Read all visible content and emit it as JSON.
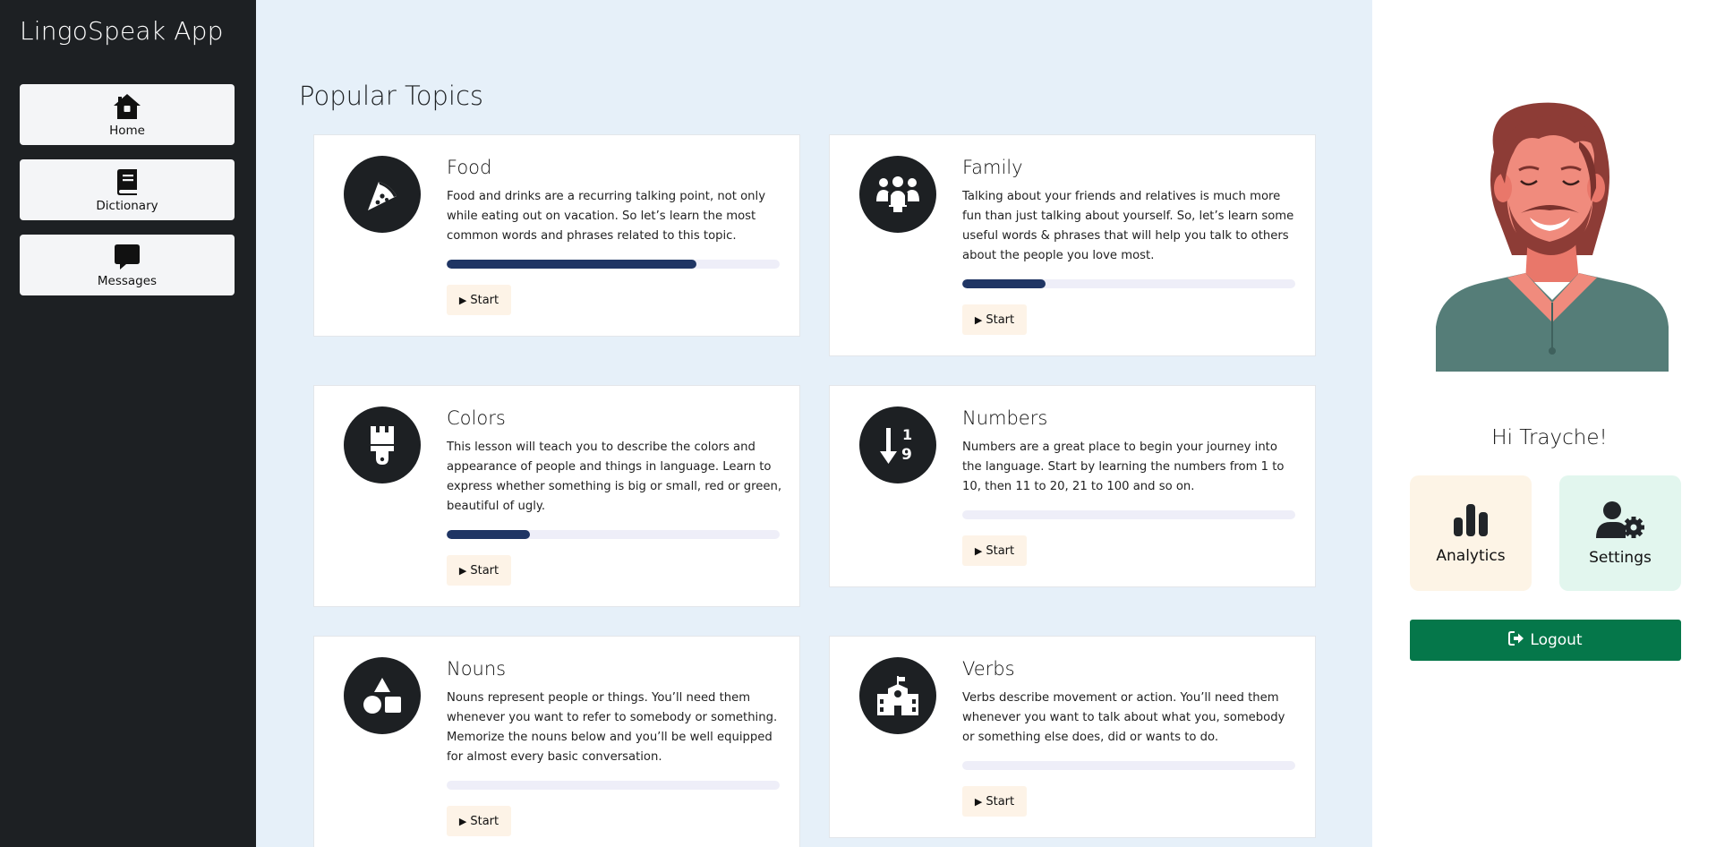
{
  "app": {
    "title": "LingoSpeak App"
  },
  "sidebar": {
    "items": [
      {
        "label": "Home",
        "icon": "home-icon"
      },
      {
        "label": "Dictionary",
        "icon": "book-icon"
      },
      {
        "label": "Messages",
        "icon": "message-icon"
      }
    ]
  },
  "main": {
    "title": "Popular Topics",
    "topics": [
      {
        "title": "Food",
        "icon": "pizza-icon",
        "description": "Food and drinks are a recurring talking point, not only while eating out on vacation. So let’s learn the most common words and phrases related to this topic.",
        "progress": 0.75,
        "start_label": "Start"
      },
      {
        "title": "Family",
        "icon": "people-group-icon",
        "description": "Talking about your friends and relatives is much more fun than just talking about yourself. So, let’s learn some useful words & phrases that will help you talk to others about the people you love most.",
        "progress": 0.25,
        "start_label": "Start"
      },
      {
        "title": "Colors",
        "icon": "paintbrush-icon",
        "description": "This lesson will teach you to describe the colors and appearance of people and things in language. Learn to express whether something is big or small, red or green, beautiful of ugly.",
        "progress": 0.25,
        "start_label": "Start"
      },
      {
        "title": "Numbers",
        "icon": "sort-numeric-down-icon",
        "description": "Numbers are a great place to begin your journey into the language. Start by learning the numbers from 1 to 10, then 11 to 20, 21 to 100 and so on.",
        "progress": 0,
        "start_label": "Start"
      },
      {
        "title": "Nouns",
        "icon": "shapes-icon",
        "description": "Nouns represent people or things. You’ll need them whenever you want to refer to somebody or something. Memorize the nouns below and you’ll be well equipped for almost every basic conversation.",
        "progress": 0,
        "start_label": "Start"
      },
      {
        "title": "Verbs",
        "icon": "school-icon",
        "description": "Verbs describe movement or action. You’ll need them whenever you want to talk about what you, somebody or something else does, did or wants to do.",
        "progress": 0,
        "start_label": "Start"
      }
    ]
  },
  "profile": {
    "greeting": "Hi Trayche!",
    "avatar_icon": "user-avatar-illustration",
    "tiles": [
      {
        "label": "Analytics",
        "icon": "bar-chart-icon",
        "bg": "#fdf4e6"
      },
      {
        "label": "Settings",
        "icon": "user-gear-icon",
        "bg": "#e2f6ee"
      }
    ],
    "logout_label": "Logout",
    "logout_color": "#05774a"
  },
  "colors": {
    "sidebar_bg": "#1d2023",
    "main_bg": "#e6f0f9",
    "progress_fill": "#1f3564"
  }
}
